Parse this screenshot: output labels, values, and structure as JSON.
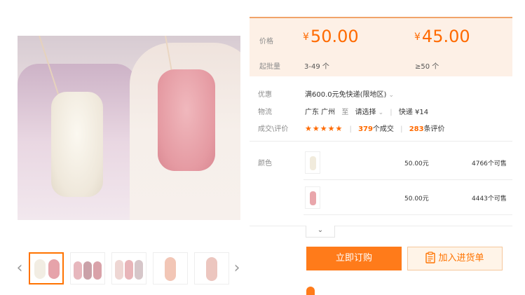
{
  "gallery": {
    "thumbs": [
      "thumb-1",
      "thumb-2",
      "thumb-3",
      "thumb-4",
      "thumb-5"
    ],
    "prev_icon": "chevron-left-icon",
    "next_icon": "chevron-right-icon",
    "prev_glyph": "‹",
    "next_glyph": "›",
    "active_border_color": "#ff7300"
  },
  "price": {
    "label": "价格",
    "currency": "¥",
    "tier1_value": "50.00",
    "tier2_value": "45.00",
    "moq_label": "起批量",
    "tier1_moq": "3-49 个",
    "tier2_moq": "≥50 个",
    "accent_color": "#ff6a00"
  },
  "info": {
    "promo_label": "优惠",
    "promo_value": "满600.0元免快递(限地区)",
    "logistics_label": "物流",
    "origin": "广东 广州",
    "to": "至",
    "destination": "请选择",
    "shipping": "快递 ¥14",
    "deals_label": "成交\\评价",
    "stars": "★★★★★",
    "deals_count": "379",
    "deals_suffix": "个成交",
    "reviews_count": "283",
    "reviews_suffix": "条评价"
  },
  "sku": {
    "label": "颜色",
    "items": [
      {
        "price": "50.00元",
        "stock": "4766个可售",
        "swatch": "#f1ebdc"
      },
      {
        "price": "50.00元",
        "stock": "4443个可售",
        "swatch": "#e9a6ab"
      }
    ],
    "expand_glyph": "⌄"
  },
  "actions": {
    "buy_label": "立即订购",
    "cart_label": "加入进货单",
    "buy_color": "#ff7b1a"
  }
}
